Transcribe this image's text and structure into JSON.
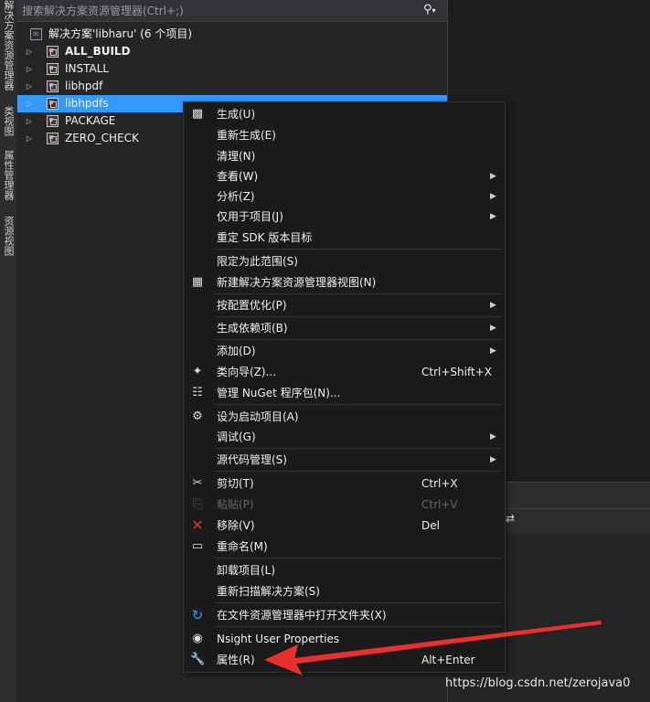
{
  "side_tabs": [
    "解决方案资源管理器",
    "类视图",
    "属性管理器",
    "资源视图"
  ],
  "search": {
    "placeholder": "搜索解决方案资源管理器(Ctrl+;)"
  },
  "tree": {
    "solution_label": "解决方案'libharu' (6 个项目)",
    "projects": [
      "ALL_BUILD",
      "INSTALL",
      "libhpdf",
      "libhpdfs",
      "PACKAGE",
      "ZERO_CHECK"
    ]
  },
  "menu": {
    "items": [
      {
        "label": "生成(U)",
        "shortcut": "",
        "icon": "build-icon"
      },
      {
        "label": "重新生成(E)",
        "shortcut": ""
      },
      {
        "label": "清理(N)",
        "shortcut": ""
      },
      {
        "label": "查看(W)",
        "shortcut": ""
      },
      {
        "label": "分析(Z)",
        "shortcut": ""
      },
      {
        "label": "仅用于项目(J)",
        "shortcut": ""
      },
      {
        "label": "重定 SDK 版本目标",
        "shortcut": ""
      },
      {
        "label": "限定为此范围(S)",
        "shortcut": ""
      },
      {
        "label": "新建解决方案资源管理器视图(N)",
        "shortcut": "",
        "icon": "new-view-icon"
      },
      {
        "label": "按配置优化(P)",
        "shortcut": ""
      },
      {
        "label": "生成依赖项(B)",
        "shortcut": ""
      },
      {
        "label": "添加(D)",
        "shortcut": ""
      },
      {
        "label": "类向导(Z)...",
        "shortcut": "Ctrl+Shift+X",
        "icon": "class-wizard-icon"
      },
      {
        "label": "管理 NuGet 程序包(N)...",
        "shortcut": "",
        "icon": "nuget-icon"
      },
      {
        "label": "设为启动项目(A)",
        "shortcut": "",
        "icon": "gear-icon"
      },
      {
        "label": "调试(G)",
        "shortcut": ""
      },
      {
        "label": "源代码管理(S)",
        "shortcut": ""
      },
      {
        "label": "剪切(T)",
        "shortcut": "Ctrl+X",
        "icon": "scissors-icon"
      },
      {
        "label": "粘贴(P)",
        "shortcut": "Ctrl+V",
        "icon": "paste-icon"
      },
      {
        "label": "移除(V)",
        "shortcut": "Del",
        "icon": "remove-icon"
      },
      {
        "label": "重命名(M)",
        "shortcut": "",
        "icon": "rename-icon"
      },
      {
        "label": "卸载项目(L)",
        "shortcut": ""
      },
      {
        "label": "重新扫描解决方案(S)",
        "shortcut": ""
      },
      {
        "label": "在文件资源管理器中打开文件夹(X)",
        "shortcut": "",
        "icon": "refresh-icon"
      },
      {
        "label": "Nsight User Properties",
        "shortcut": "",
        "icon": "globe-icon"
      },
      {
        "label": "属性(R)",
        "shortcut": "Alt+Enter",
        "icon": "wrench-icon"
      }
    ]
  },
  "colors": {
    "selection": "#3399ff",
    "annotation_arrow": "#e8312f",
    "menu_bg": "#1b1b1c"
  },
  "watermark": "https://blog.csdn.net/zerojava0"
}
